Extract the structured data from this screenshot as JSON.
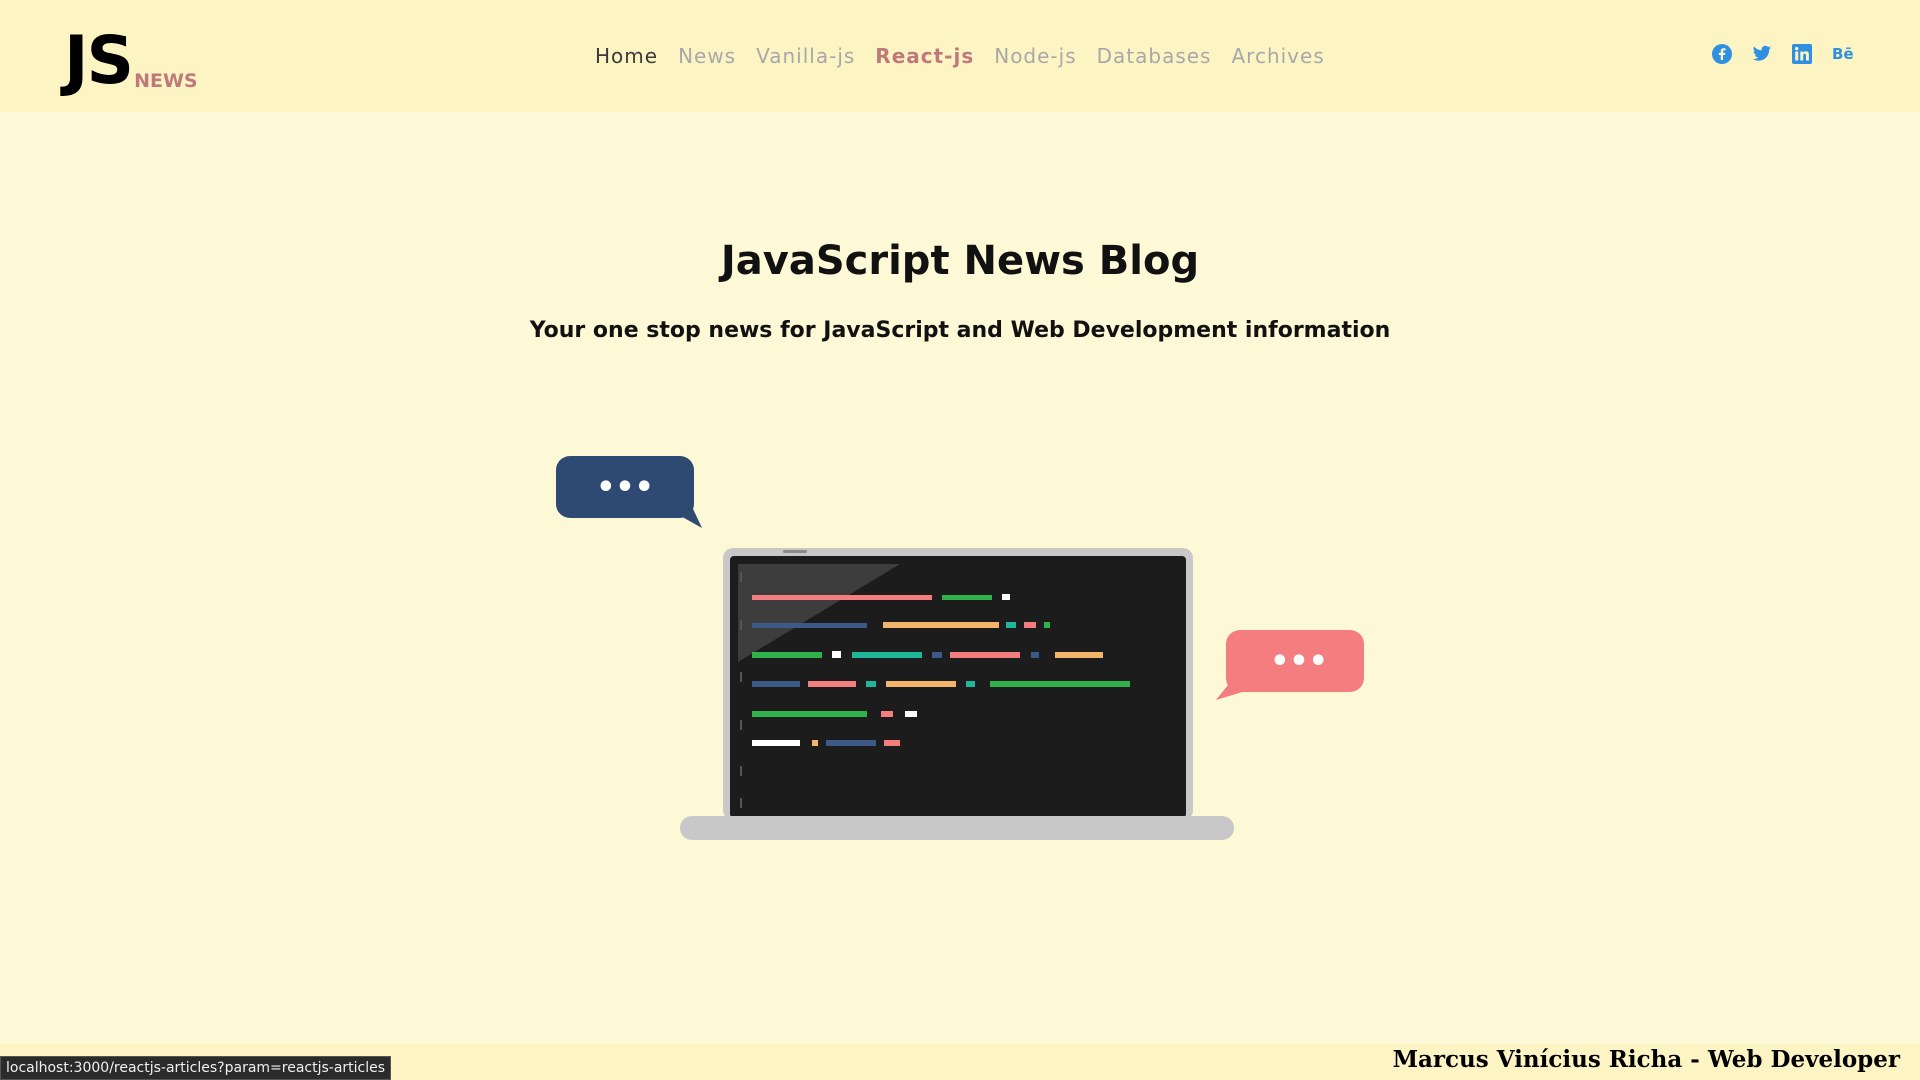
{
  "header": {
    "logo_main": "JS",
    "logo_sub": "NEWS",
    "nav": [
      {
        "label": "Home",
        "state": "home"
      },
      {
        "label": "News",
        "state": "default"
      },
      {
        "label": "Vanilla-js",
        "state": "default"
      },
      {
        "label": "React-js",
        "state": "active"
      },
      {
        "label": "Node-js",
        "state": "default"
      },
      {
        "label": "Databases",
        "state": "default"
      },
      {
        "label": "Archives",
        "state": "default"
      }
    ],
    "social": {
      "icons": [
        "facebook-icon",
        "twitter-icon",
        "linkedin-icon",
        "behance-icon"
      ],
      "behance_label": "Bē",
      "color": "#2f8fe0"
    }
  },
  "hero": {
    "title": "JavaScript News Blog",
    "subtitle": "Your one stop news for JavaScript and Web Development information",
    "illustration": {
      "left_bubble_text": "•••",
      "right_bubble_text": "•••",
      "left_bubble_color": "#2e4a73",
      "right_bubble_color": "#f47d7f"
    }
  },
  "footer": {
    "credit": "Marcus Vinícius Richa - Web Developer"
  },
  "status_bar": {
    "url": "localhost:3000/reactjs-articles?param=reactjs-articles"
  },
  "colors": {
    "background": "#fdf8d6",
    "header_bg": "#fdf4c4",
    "accent": "#c0797a"
  }
}
